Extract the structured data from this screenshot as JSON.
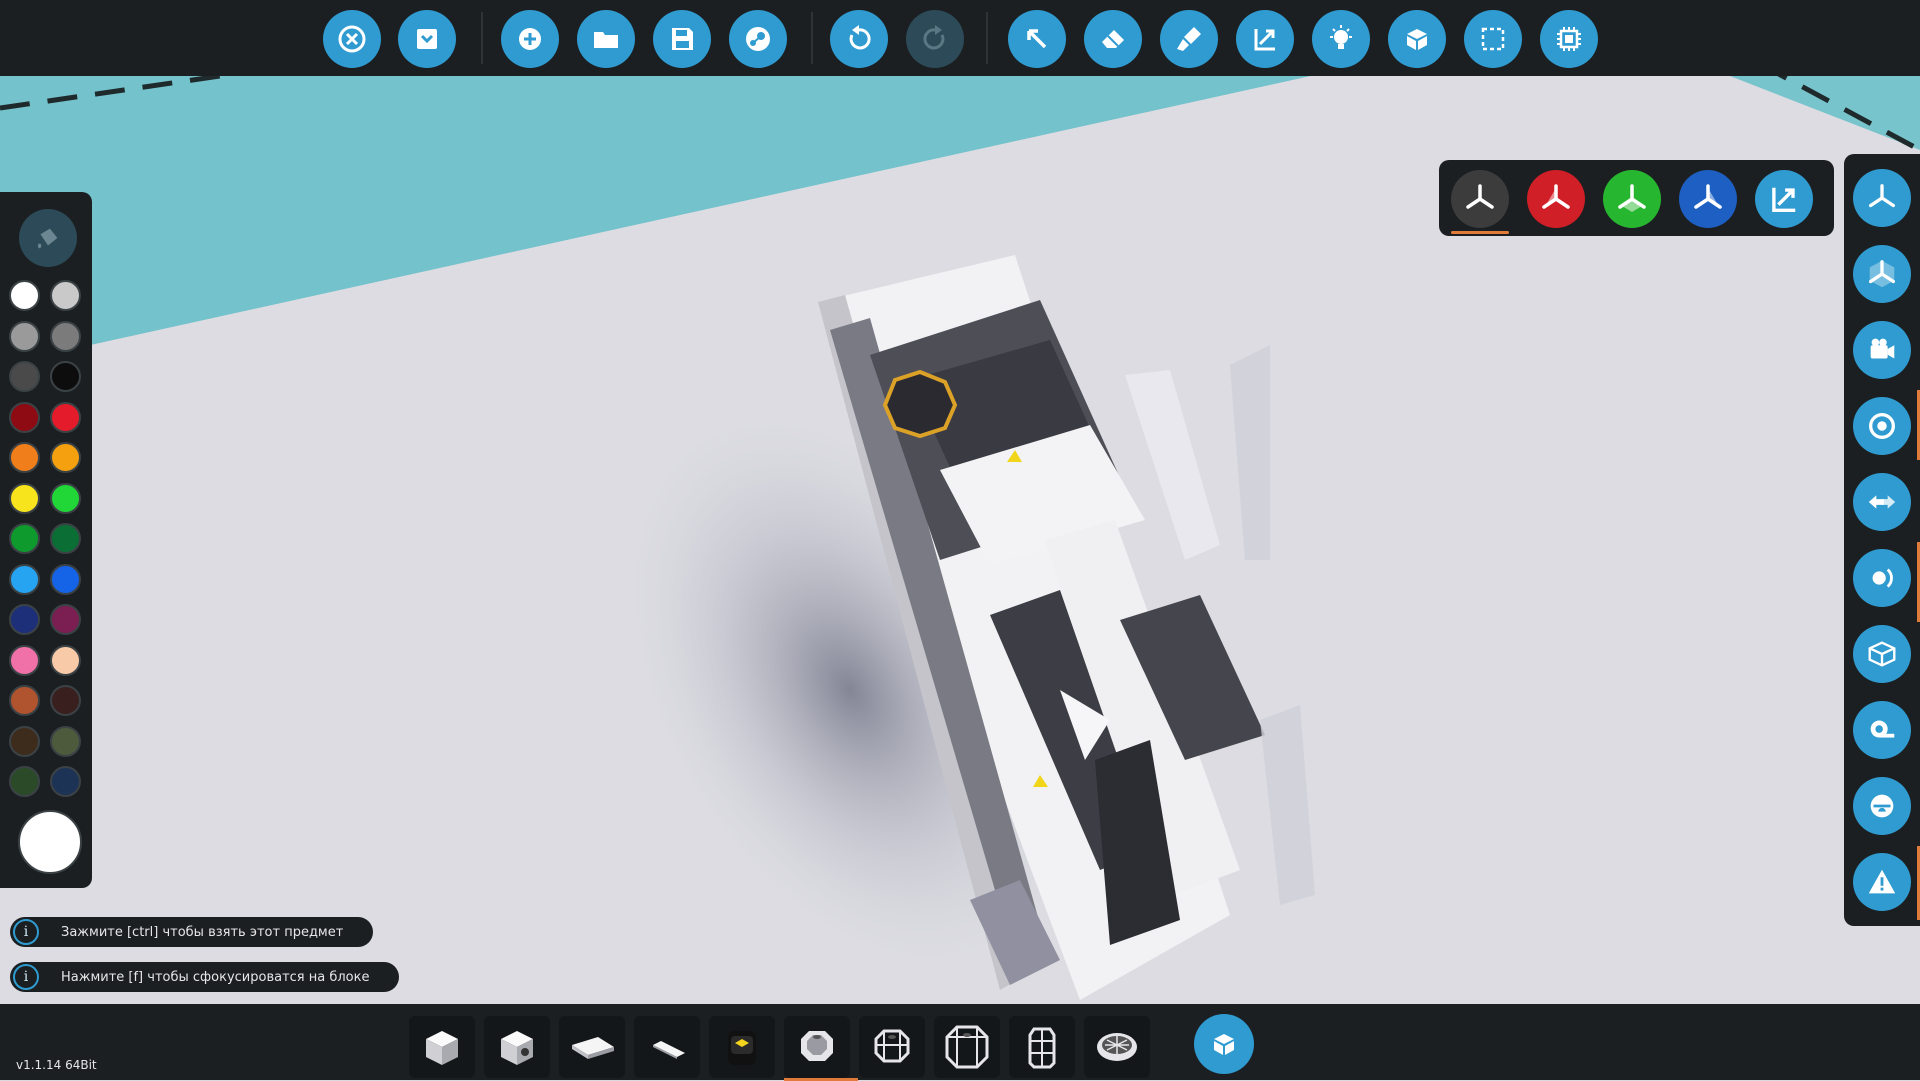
{
  "toolbar": {
    "left_group": [
      {
        "name": "close-button",
        "icon": "close-x-icon"
      },
      {
        "name": "workbench-menu-button",
        "icon": "checkbox-menu-icon"
      }
    ],
    "file_group": [
      {
        "name": "new-vehicle-button",
        "icon": "plus-icon"
      },
      {
        "name": "open-button",
        "icon": "folder-icon"
      },
      {
        "name": "save-button",
        "icon": "floppy-icon"
      },
      {
        "name": "steam-workshop-button",
        "icon": "steam-icon"
      }
    ],
    "history_group": [
      {
        "name": "undo-button",
        "icon": "undo-icon",
        "enabled": true
      },
      {
        "name": "redo-button",
        "icon": "redo-icon",
        "enabled": false
      }
    ],
    "tools_group": [
      {
        "name": "select-tool-button",
        "icon": "cursor-arrow-icon"
      },
      {
        "name": "erase-tool-button",
        "icon": "eraser-icon"
      },
      {
        "name": "paint-tool-button",
        "icon": "paint-brush-icon"
      },
      {
        "name": "scale-tool-button",
        "icon": "resize-arrows-icon"
      },
      {
        "name": "lighting-button",
        "icon": "lightbulb-icon"
      },
      {
        "name": "merge-button",
        "icon": "cubes-icon"
      },
      {
        "name": "selection-box-button",
        "icon": "dashed-square-icon"
      },
      {
        "name": "microprocessor-button",
        "icon": "chip-icon"
      }
    ]
  },
  "palette": {
    "mode_icon": "paint-bucket-icon",
    "colors": [
      [
        "#ffffff",
        "#c9c9c9"
      ],
      [
        "#9a9a9a",
        "#7b7b7b"
      ],
      [
        "#4a4a4a",
        "#0d0d0d"
      ],
      [
        "#8e0b13",
        "#e41b2a"
      ],
      [
        "#f07e1a",
        "#f5a00f"
      ],
      [
        "#f7e41d",
        "#21d637"
      ],
      [
        "#0e9a2d",
        "#0b6e34"
      ],
      [
        "#27a4f1",
        "#1563e6"
      ],
      [
        "#1e2f7a",
        "#7b1e52"
      ],
      [
        "#f070a8",
        "#f8caa8"
      ],
      [
        "#b0542f",
        "#3a1f1f"
      ],
      [
        "#3d2c1c",
        "#4e5a3c"
      ],
      [
        "#2b4a28",
        "#1d3356"
      ]
    ],
    "current_color": "#ffffff"
  },
  "gizmo": {
    "buttons": [
      {
        "name": "axis-all-button",
        "color": "#3c3c3c"
      },
      {
        "name": "axis-x-button",
        "color": "#d01f26"
      },
      {
        "name": "axis-y-button",
        "color": "#27b62f"
      },
      {
        "name": "axis-z-button",
        "color": "#1d5fc2"
      },
      {
        "name": "axis-scale-button",
        "color": "#2f9bd0"
      }
    ]
  },
  "rightbar": {
    "buttons": [
      {
        "name": "transform-gizmo-button",
        "icon": "tri-axis-icon"
      },
      {
        "name": "local-axis-button",
        "icon": "tri-axis-cube-icon"
      },
      {
        "name": "camera-button",
        "icon": "camera-icon"
      },
      {
        "name": "center-of-mass-button",
        "icon": "target-icon"
      },
      {
        "name": "logic-links-button",
        "icon": "arrows-exchange-icon"
      },
      {
        "name": "rotation-button",
        "icon": "rotation-icon"
      },
      {
        "name": "bounding-box-button",
        "icon": "box-outline-icon"
      },
      {
        "name": "measure-button",
        "icon": "tape-measure-icon"
      },
      {
        "name": "seat-button",
        "icon": "seat-icon"
      },
      {
        "name": "warnings-button",
        "icon": "warning-icon"
      }
    ]
  },
  "hints": [
    {
      "text": "Зажмите [ctrl] чтобы взять этот предмет"
    },
    {
      "text": "Нажмите [f] чтобы сфокусироватся на блоке"
    }
  ],
  "hint_icon_glyph": "i",
  "blocks": [
    {
      "name": "block-cube"
    },
    {
      "name": "block-wedge-cube"
    },
    {
      "name": "block-plate"
    },
    {
      "name": "block-thin-plate"
    },
    {
      "name": "block-seat"
    },
    {
      "name": "block-octagon-thruster",
      "selected": true
    },
    {
      "name": "block-octagon-cage"
    },
    {
      "name": "block-octagon-large"
    },
    {
      "name": "block-tall-cage"
    },
    {
      "name": "block-turbine"
    }
  ],
  "version": "v1.1.14 64Bit"
}
